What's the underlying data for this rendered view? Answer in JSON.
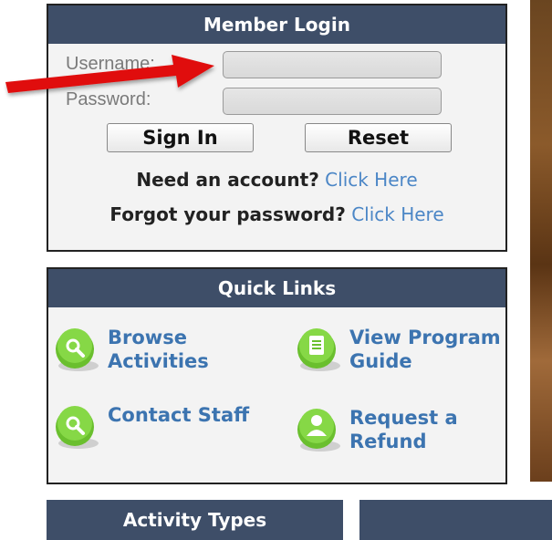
{
  "login": {
    "title": "Member Login",
    "username_label": "Username:",
    "password_label": "Password:",
    "sign_in": "Sign In",
    "reset": "Reset",
    "need_account_q": "Need an account?",
    "need_account_link": "Click Here",
    "forgot_q": "Forgot your password?",
    "forgot_link": "Click Here"
  },
  "quick_links": {
    "title": "Quick Links",
    "items": [
      {
        "line1": "Browse",
        "line2": "Activities",
        "icon": "search-icon"
      },
      {
        "line1": "View Program",
        "line2": "Guide",
        "icon": "document-icon"
      },
      {
        "line1": "Contact Staff",
        "line2": "",
        "icon": "search-icon"
      },
      {
        "line1": "Request a",
        "line2": "Refund",
        "icon": "user-icon"
      }
    ]
  },
  "activity_types": {
    "title": "Activity Types"
  },
  "colors": {
    "header": "#3e4e68",
    "link": "#4b86c6",
    "arrow": "#e01010",
    "icon_green": "#6abf2e"
  }
}
